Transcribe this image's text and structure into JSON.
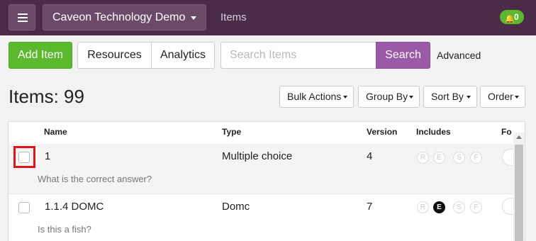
{
  "nav": {
    "organization": "Caveon Technology Demo",
    "breadcrumb": "Items",
    "notifications": "0"
  },
  "toolbar": {
    "add_label": "Add Item",
    "resources_label": "Resources",
    "analytics_label": "Analytics",
    "search_placeholder": "Search Items",
    "search_label": "Search",
    "advanced_label": "Advanced"
  },
  "heading": {
    "title": "Items: 99",
    "bulk_actions": "Bulk Actions",
    "group_by": "Group By",
    "sort_by": "Sort By",
    "order": "Order"
  },
  "table": {
    "columns": [
      "Name",
      "Type",
      "Version",
      "Includes",
      "Fo"
    ],
    "include_letters": [
      "R",
      "E",
      "S",
      "F"
    ],
    "rows": [
      {
        "name": "1",
        "type": "Multiple choice",
        "version": "4",
        "description": "What is the correct answer?",
        "includes_active": []
      },
      {
        "name": "1.1.4 DOMC",
        "type": "Domc",
        "version": "7",
        "description": "Is this a fish?",
        "includes_active": [
          "E"
        ]
      }
    ]
  },
  "colors": {
    "nav_bg": "#4a2b48",
    "add_green": "#5cb82e",
    "search_purple": "#9b5aa6",
    "highlight_red": "#e0131b"
  }
}
